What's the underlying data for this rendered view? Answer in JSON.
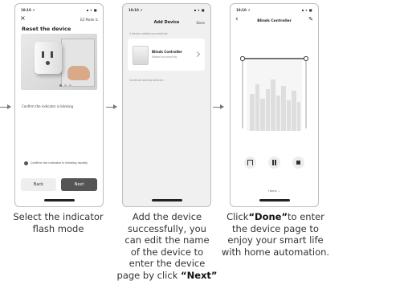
{
  "screens": {
    "reset": {
      "time": "10:10 ↗",
      "status_icons": "▪ ▾ ■",
      "close": "×",
      "mode_link": "EZ Mode ⇅",
      "title": "Reset the device",
      "instruction": "Confirm the indicator is blinking",
      "confirm_label": "Confirm the indicator is blinking rapidly",
      "back_label": "Back",
      "next_label": "Next"
    },
    "add": {
      "time": "10:10 ↗",
      "status_icons": "▪ ▾ ■",
      "title": "Add Device",
      "done_label": "Done",
      "section_label": "1 device added successfully",
      "device_name": "Blinds Controller",
      "device_sub": "Added successfully",
      "hint": "Continue adding devices  ›"
    },
    "control": {
      "time": "10:10 ↗",
      "status_icons": "▪ ▾ ■",
      "back": "‹",
      "title": "Blinds Controller",
      "edit": "✎",
      "bottom_label": "Home ⌄"
    }
  },
  "captions": {
    "one": [
      "Select the indicator",
      "flash mode"
    ],
    "two": [
      "Add the device",
      "successfully, you",
      "can edit the name",
      "of the device to",
      "enter the device",
      "page by click ",
      "“Next”"
    ],
    "three": [
      "Click",
      "“Done”",
      "to enter",
      "the device page to",
      "enjoy your smart life",
      "with home automation."
    ]
  }
}
